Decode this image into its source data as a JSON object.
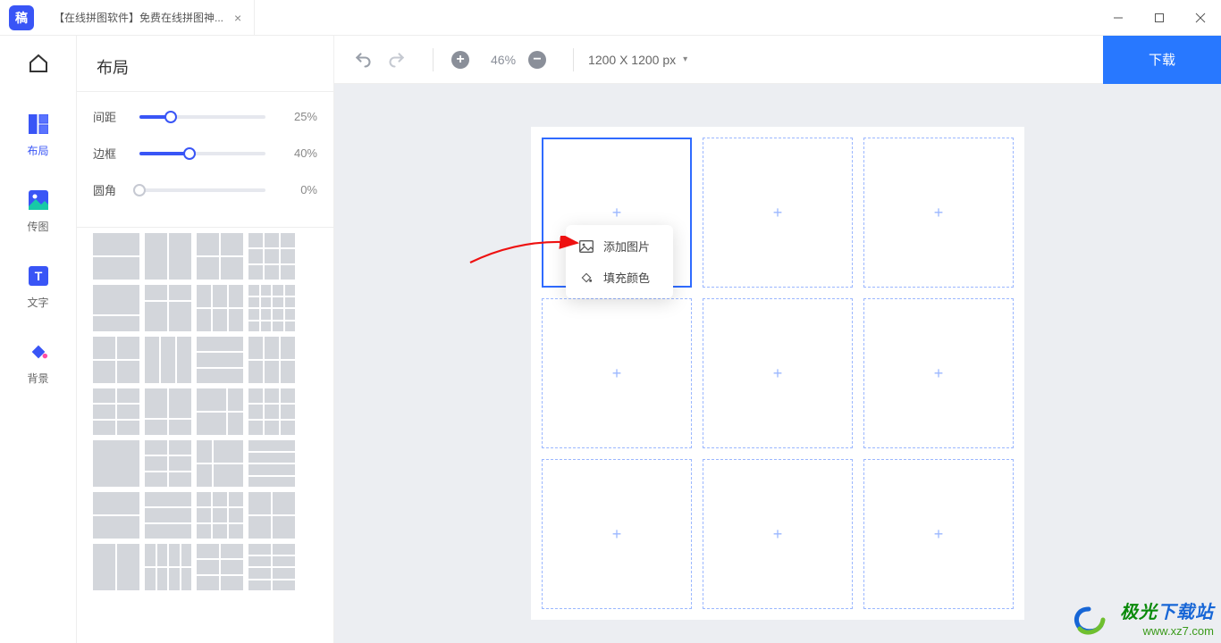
{
  "app": {
    "logo_text": "稿",
    "tab_title": "【在线拼图软件】免费在线拼图神..."
  },
  "rail": {
    "home": "",
    "layout": "布局",
    "upload": "传图",
    "text": "文字",
    "background": "背景"
  },
  "panel": {
    "title": "布局",
    "sliders": {
      "spacing": {
        "label": "间距",
        "value_pct": 25,
        "display": "25%"
      },
      "border": {
        "label": "边框",
        "value_pct": 40,
        "display": "40%"
      },
      "radius": {
        "label": "圆角",
        "value_pct": 0,
        "display": "0%"
      }
    }
  },
  "toolbar": {
    "zoom_display": "46%",
    "dimensions": "1200 X 1200 px",
    "download": "下载"
  },
  "context_menu": {
    "add_image": "添加图片",
    "fill_color": "填充颜色"
  },
  "canvas": {
    "grid": {
      "rows": 3,
      "cols": 3,
      "selected_index": 0
    }
  },
  "watermark": {
    "brand_cn": "极光下载站",
    "url": "www.xz7.com"
  }
}
